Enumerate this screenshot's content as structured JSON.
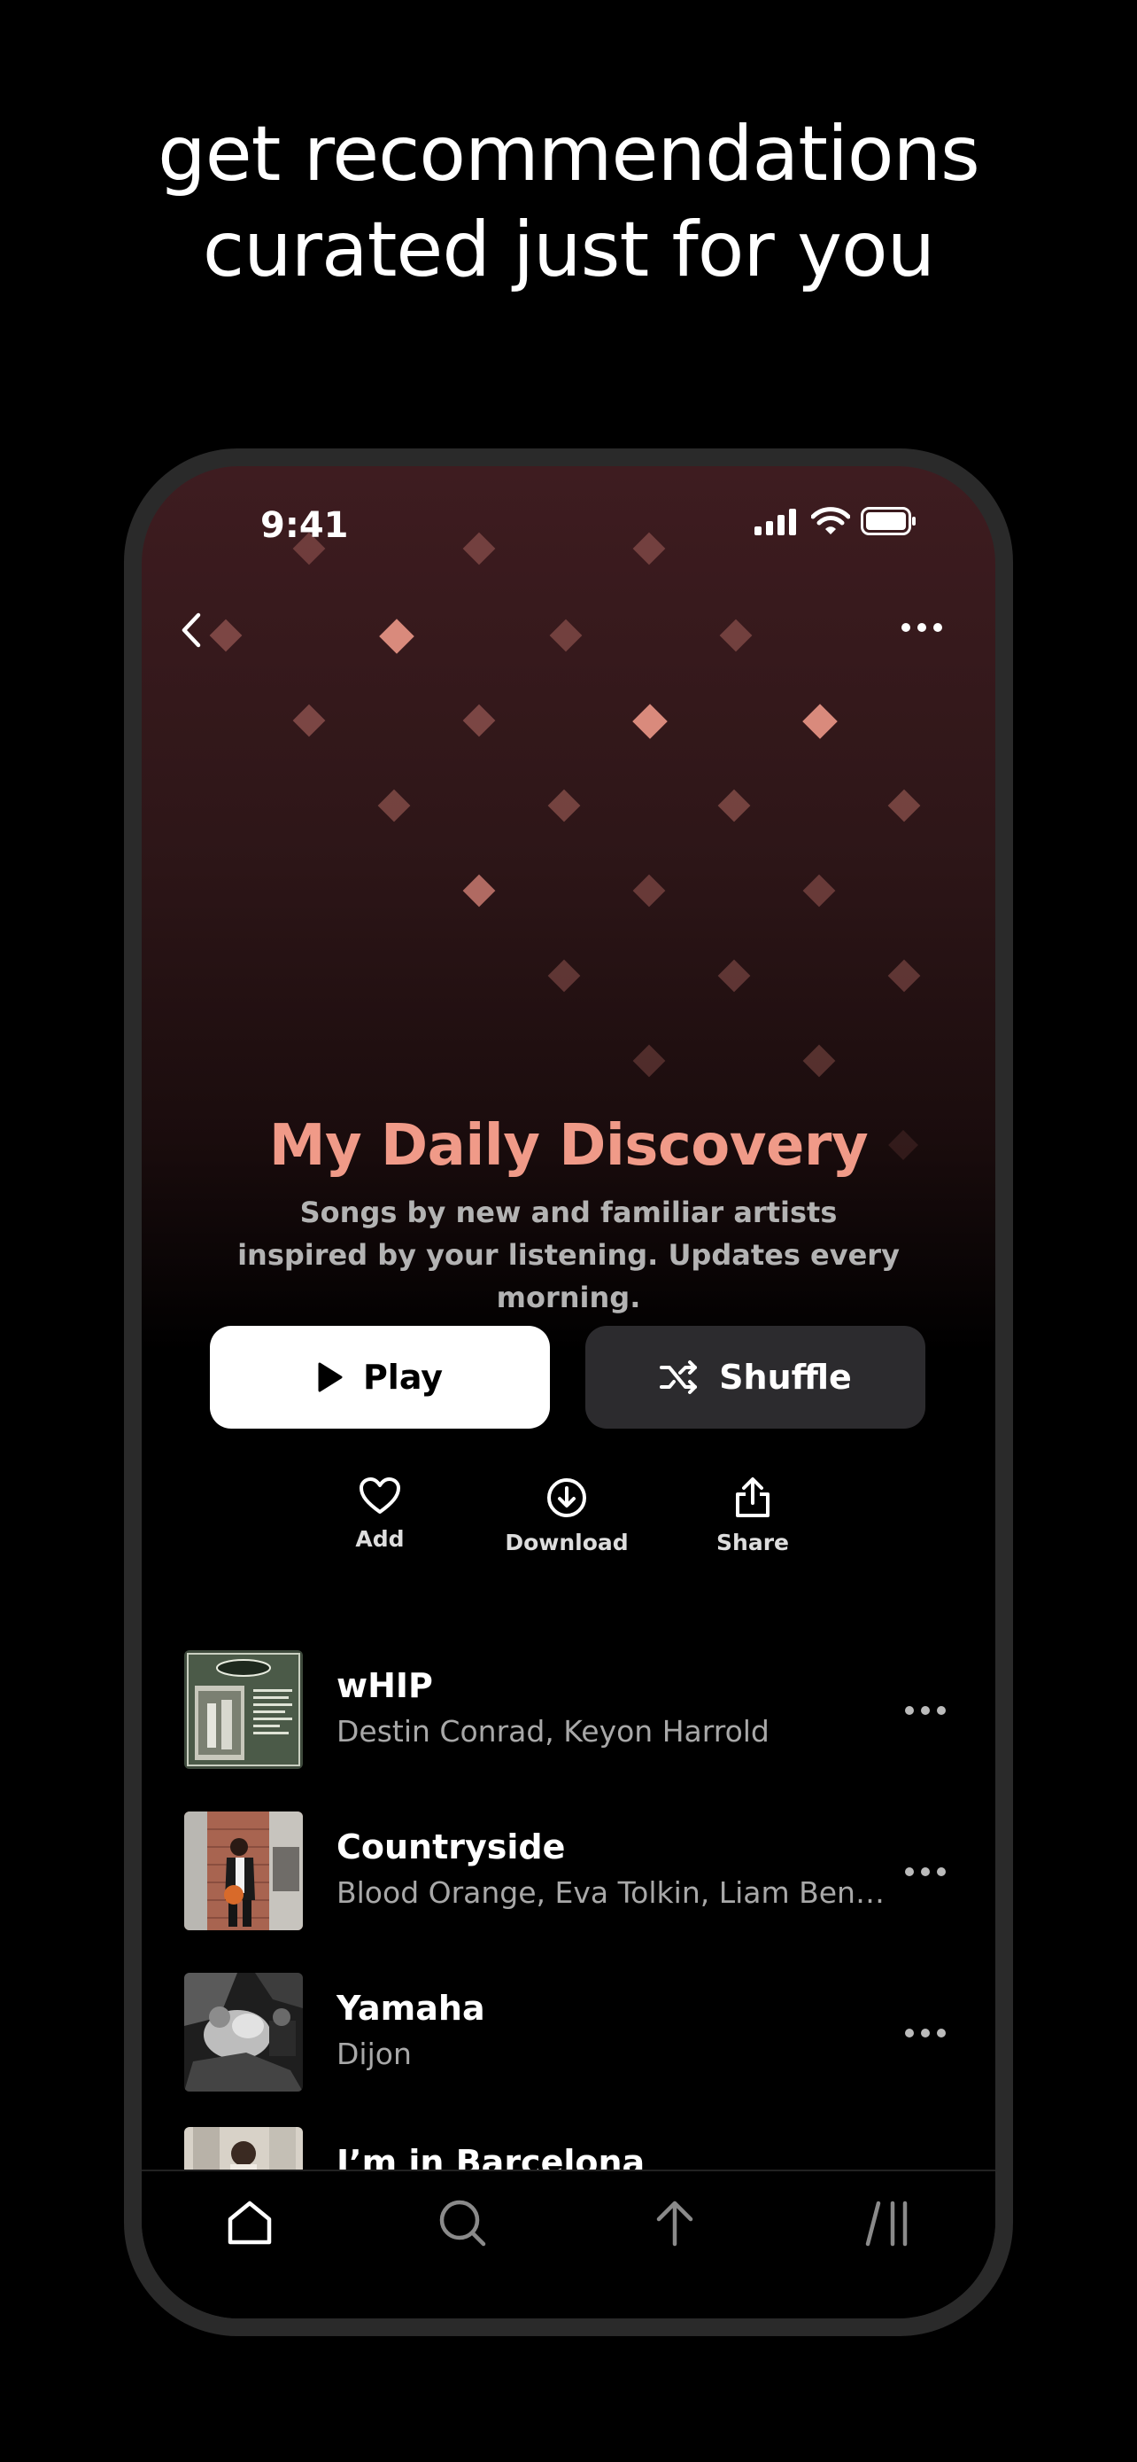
{
  "headline": {
    "line1": "get recommendations",
    "line2": "curated just for you"
  },
  "status_bar": {
    "time": "9:41"
  },
  "playlist": {
    "title": "My Daily Discovery",
    "description": "Songs by new and familiar artists inspired by your listening. Updates every morning.",
    "accent_color": "#f09a88"
  },
  "buttons": {
    "play_label": "Play",
    "shuffle_label": "Shuffle"
  },
  "actions": {
    "add_label": "Add",
    "download_label": "Download",
    "share_label": "Share"
  },
  "tracks": [
    {
      "title": "wHIP",
      "artist": "Destin Conrad, Keyon Harrold"
    },
    {
      "title": "Countryside",
      "artist": "Blood Orange, Eva Tolkin, Liam Benz..."
    },
    {
      "title": "Yamaha",
      "artist": "Dijon"
    },
    {
      "title": "I’m in Barcelona",
      "artist": ""
    }
  ],
  "tabs": [
    "home-icon",
    "search-icon",
    "upload-icon",
    "library-icon"
  ]
}
